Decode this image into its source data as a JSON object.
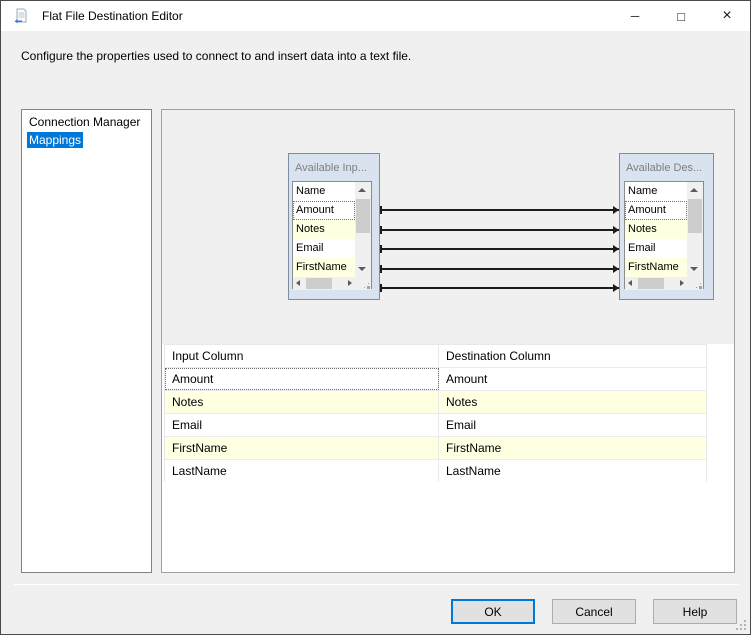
{
  "window": {
    "title": "Flat File Destination Editor",
    "minimize_icon": "─",
    "maximize_icon": "□",
    "close_icon": "×"
  },
  "header": {
    "description": "Configure the properties used to connect to and insert data into a text file."
  },
  "sidebar": {
    "items": [
      {
        "label": "Connection Manager",
        "selected": false
      },
      {
        "label": "Mappings",
        "selected": true
      }
    ]
  },
  "diagram": {
    "available_inputs": {
      "title": "Available Inp...",
      "column_header": "Name",
      "columns": [
        "Amount",
        "Notes",
        "Email",
        "FirstName"
      ]
    },
    "available_destinations": {
      "title": "Available Des...",
      "column_header": "Name",
      "columns": [
        "Amount",
        "Notes",
        "Email",
        "FirstName"
      ]
    },
    "connections": [
      {
        "from": "Amount",
        "to": "Amount"
      },
      {
        "from": "Notes",
        "to": "Notes"
      },
      {
        "from": "Email",
        "to": "Email"
      },
      {
        "from": "FirstName",
        "to": "FirstName"
      },
      {
        "from": "LastName",
        "to": "LastName"
      }
    ]
  },
  "mapping_table": {
    "headers": [
      "Input Column",
      "Destination Column"
    ],
    "rows": [
      {
        "input": "Amount",
        "destination": "Amount"
      },
      {
        "input": "Notes",
        "destination": "Notes"
      },
      {
        "input": "Email",
        "destination": "Email"
      },
      {
        "input": "FirstName",
        "destination": "FirstName"
      },
      {
        "input": "LastName",
        "destination": "LastName"
      }
    ]
  },
  "footer": {
    "ok": "OK",
    "cancel": "Cancel",
    "help": "Help"
  },
  "colors": {
    "accent": "#0078d7",
    "highlight_row": "#ffffe1",
    "selection_bg": "#0078d7",
    "selection_text": "#ffffff"
  }
}
